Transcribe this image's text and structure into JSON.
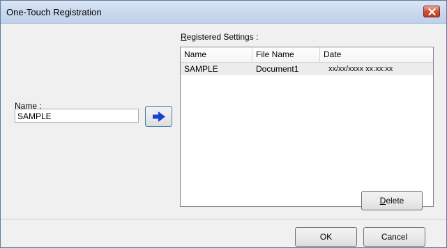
{
  "window": {
    "title": "One-Touch Registration"
  },
  "registered": {
    "label_mnemonic": "R",
    "label_rest": "egistered Settings :",
    "columns": [
      "Name",
      "File Name",
      "Date"
    ],
    "rows": [
      {
        "name": "SAMPLE",
        "file_name": "Document1",
        "date": "xx/xx/xxxx  xx:xx:xx"
      }
    ]
  },
  "name_field": {
    "label_pre": "Nam",
    "label_mnemonic": "e",
    "label_post": " :",
    "value": "SAMPLE"
  },
  "buttons": {
    "delete_mnemonic": "D",
    "delete_rest": "elete",
    "ok": "OK",
    "cancel": "Cancel"
  },
  "icons": {
    "register_arrow": "right-arrow-icon",
    "close": "close-icon"
  },
  "colors": {
    "arrow": "#1a3fd6",
    "close_button": "#c94a32",
    "selected_row": "#ececec"
  }
}
